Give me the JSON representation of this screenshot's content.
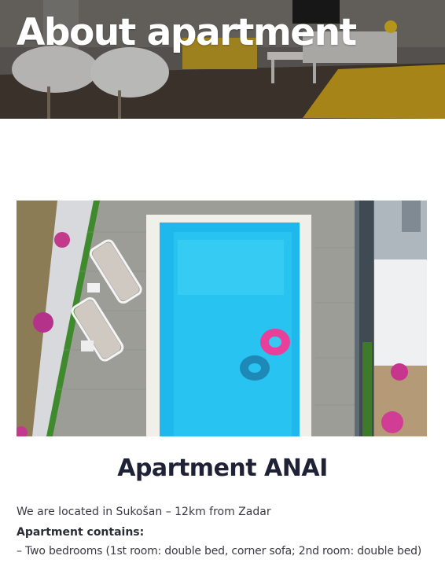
{
  "hero": {
    "title": "About apartment"
  },
  "photo": {
    "subject": "pool-photo"
  },
  "content": {
    "apartment_title": "Apartment ANAI",
    "location_line": "We are located in Sukošan – 12km from Zadar",
    "contains_label": "Apartment contains:",
    "bedrooms_line": "– Two bedrooms (1st room: double bed, corner sofa; 2nd room: double bed)"
  },
  "colors": {
    "pool_water": "#1fb8ec",
    "float_ring": "#e83f9a",
    "title_text": "#1f2236"
  }
}
